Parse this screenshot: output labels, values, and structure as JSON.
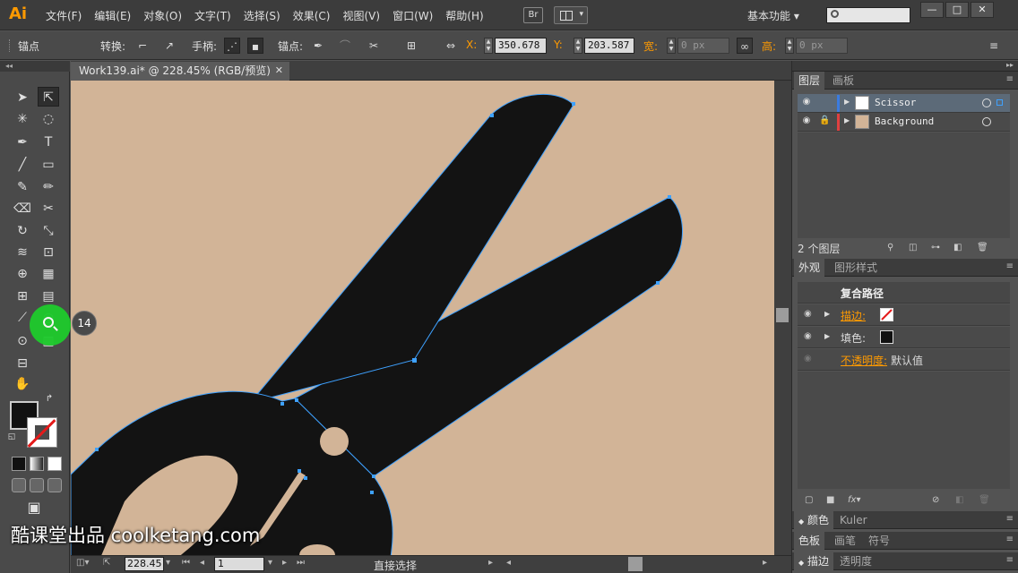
{
  "app": {
    "logo": "Ai",
    "menus": [
      "文件(F)",
      "编辑(E)",
      "对象(O)",
      "文字(T)",
      "选择(S)",
      "效果(C)",
      "视图(V)",
      "窗口(W)",
      "帮助(H)"
    ],
    "bridge_label": "Br",
    "workspace": "基本功能 ▾"
  },
  "control_bar": {
    "anchor_label": "锚点",
    "convert_label": "转换:",
    "handles_label": "手柄:",
    "anchors_label": "锚点:",
    "x_label": "X:",
    "x_value": "350.678 p",
    "y_label": "Y:",
    "y_value": "203.587 p",
    "width_label": "宽:",
    "width_value": "0 px",
    "height_label": "高:",
    "height_value": "0 px"
  },
  "document": {
    "tab_title": "Work139.ai* @ 228.45% (RGB/预览)",
    "zoom": "228.45",
    "page": "1",
    "status": "直接选择"
  },
  "tutorial": {
    "step": "14"
  },
  "layers_panel": {
    "tabs": [
      "图层",
      "画板"
    ],
    "layers": [
      {
        "name": "Scissor",
        "color": "#3a7be0"
      },
      {
        "name": "Background",
        "color": "#e04040"
      }
    ],
    "count": "2 个图层"
  },
  "appearance_panel": {
    "tabs": [
      "外观",
      "图形样式"
    ],
    "title": "复合路径",
    "stroke_label": "描边:",
    "fill_label": "填色:",
    "opacity_label": "不透明度:",
    "opacity_value": "默认值"
  },
  "collapsed_panels": {
    "color_tabs": [
      "颜色",
      "Kuler"
    ],
    "swatch_tabs": [
      "色板",
      "画笔",
      "符号"
    ],
    "stroke_tabs": [
      "描边",
      "透明度"
    ]
  },
  "colors": {
    "canvas_bg": "#d2b497",
    "shape_fill": "#131313",
    "path_selection": "#3ea1ff",
    "highlight": "#1ecb2c"
  },
  "watermark": "酷课堂出品 coolketang.com"
}
